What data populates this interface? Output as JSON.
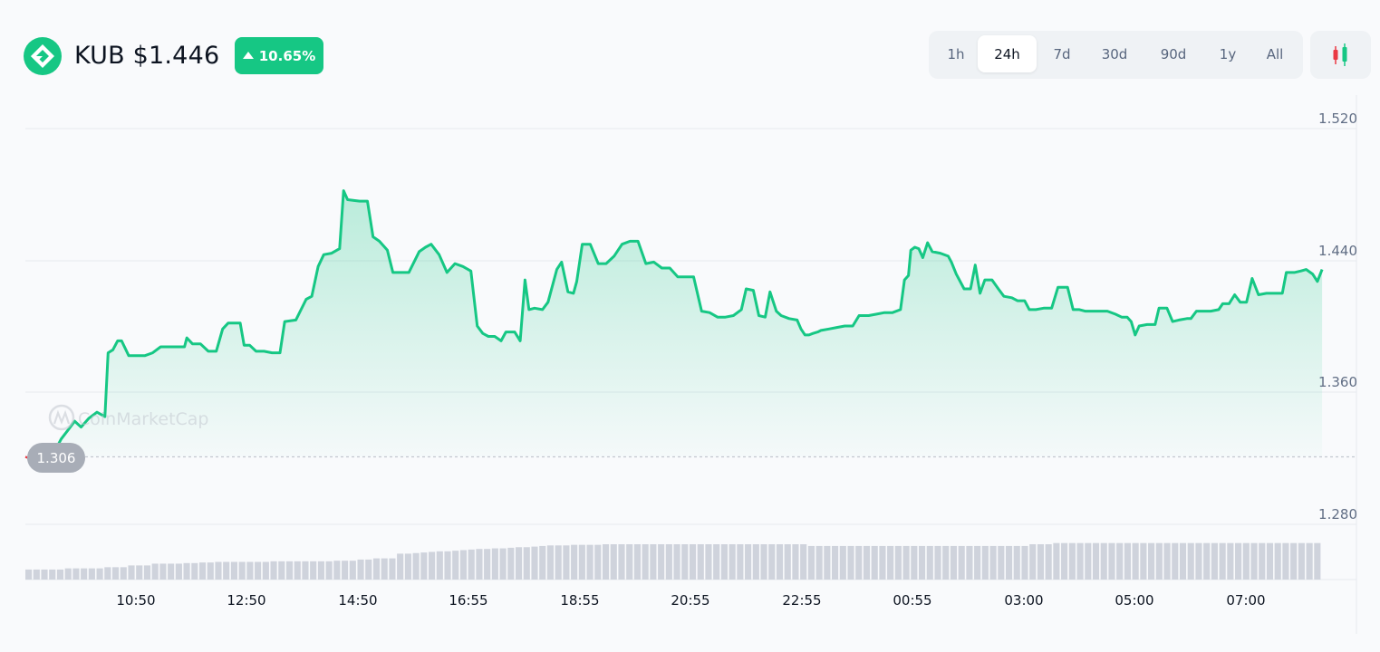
{
  "header": {
    "title": "KUB $1.446",
    "change": "10.65%",
    "change_direction": "up",
    "logo_icon": "kub-logo-icon",
    "accent_color": "#16c784"
  },
  "time_tabs": [
    {
      "label": "1h",
      "active": false
    },
    {
      "label": "24h",
      "active": true
    },
    {
      "label": "7d",
      "active": false
    },
    {
      "label": "30d",
      "active": false
    },
    {
      "label": "90d",
      "active": false
    },
    {
      "label": "1y",
      "active": false
    },
    {
      "label": "All",
      "active": false
    }
  ],
  "candle_button_icon": "candlestick-icon",
  "watermark": "CoinMarketCap",
  "chart_data": {
    "type": "area",
    "y_ticks": [
      "1.520",
      "1.440",
      "1.360",
      "1.280"
    ],
    "x_ticks": [
      "10:50",
      "12:50",
      "14:50",
      "16:55",
      "18:55",
      "20:55",
      "22:55",
      "00:55",
      "03:00",
      "05:00",
      "07:00"
    ],
    "reference_price": 1.306,
    "reference_label": "1.306",
    "ylim": [
      1.2606,
      1.5268
    ],
    "up_color": "#16c784",
    "down_color": "#ea3943",
    "grid": true,
    "series": [
      {
        "points": [
          [
            0.0,
            1.306
          ],
          [
            0.5,
            1.305
          ],
          [
            1.0,
            1.305
          ],
          [
            1.5,
            1.301
          ],
          [
            2.0,
            1.297
          ],
          [
            2.5,
            1.297
          ],
          [
            3.0,
            1.301
          ],
          [
            3.3,
            1.297
          ],
          [
            3.8,
            1.311
          ],
          [
            4.5,
            1.318
          ],
          [
            5.5,
            1.325
          ],
          [
            6.2,
            1.33
          ],
          [
            7.0,
            1.326
          ],
          [
            8.0,
            1.332
          ],
          [
            9.0,
            1.336
          ],
          [
            10.0,
            1.333
          ],
          [
            10.4,
            1.376
          ],
          [
            11.0,
            1.378
          ],
          [
            11.6,
            1.384
          ],
          [
            12.1,
            1.384
          ],
          [
            13.0,
            1.374
          ],
          [
            15.0,
            1.374
          ],
          [
            16.0,
            1.376
          ],
          [
            17.0,
            1.38
          ],
          [
            17.6,
            1.38
          ],
          [
            19.0,
            1.38
          ],
          [
            20.0,
            1.38
          ],
          [
            20.3,
            1.386
          ],
          [
            21.0,
            1.382
          ],
          [
            22.0,
            1.382
          ],
          [
            23.0,
            1.377
          ],
          [
            24.0,
            1.377
          ],
          [
            24.8,
            1.392
          ],
          [
            25.5,
            1.396
          ],
          [
            27.0,
            1.396
          ],
          [
            27.5,
            1.381
          ],
          [
            28.2,
            1.381
          ],
          [
            29.0,
            1.377
          ],
          [
            30.0,
            1.377
          ],
          [
            31.0,
            1.376
          ],
          [
            32.0,
            1.376
          ],
          [
            32.6,
            1.397
          ],
          [
            34.0,
            1.398
          ],
          [
            35.3,
            1.412
          ],
          [
            36.0,
            1.414
          ],
          [
            36.8,
            1.434
          ],
          [
            37.5,
            1.442
          ],
          [
            38.5,
            1.443
          ],
          [
            39.5,
            1.446
          ],
          [
            40.0,
            1.485
          ],
          [
            40.5,
            1.479
          ],
          [
            42.0,
            1.478
          ],
          [
            43.0,
            1.478
          ],
          [
            43.7,
            1.454
          ],
          [
            44.5,
            1.451
          ],
          [
            45.5,
            1.445
          ],
          [
            46.2,
            1.43
          ],
          [
            47.2,
            1.43
          ],
          [
            48.2,
            1.43
          ],
          [
            49.5,
            1.444
          ],
          [
            50.3,
            1.447
          ],
          [
            51.0,
            1.449
          ],
          [
            52.0,
            1.442
          ],
          [
            53.0,
            1.43
          ],
          [
            54.0,
            1.436
          ],
          [
            55.0,
            1.434
          ],
          [
            56.0,
            1.431
          ],
          [
            56.8,
            1.394
          ],
          [
            57.5,
            1.389
          ],
          [
            58.2,
            1.387
          ],
          [
            59.0,
            1.387
          ],
          [
            59.8,
            1.384
          ],
          [
            60.4,
            1.39
          ],
          [
            61.5,
            1.39
          ],
          [
            62.2,
            1.384
          ],
          [
            62.8,
            1.425
          ],
          [
            63.3,
            1.405
          ],
          [
            64.0,
            1.406
          ],
          [
            65.0,
            1.405
          ],
          [
            65.7,
            1.41
          ],
          [
            66.8,
            1.432
          ],
          [
            67.4,
            1.437
          ],
          [
            68.2,
            1.417
          ],
          [
            68.9,
            1.416
          ],
          [
            69.3,
            1.424
          ],
          [
            70.0,
            1.449
          ],
          [
            71.0,
            1.449
          ],
          [
            72.0,
            1.436
          ],
          [
            73.0,
            1.436
          ],
          [
            74.0,
            1.441
          ],
          [
            75.0,
            1.449
          ],
          [
            76.0,
            1.451
          ],
          [
            77.0,
            1.451
          ],
          [
            78.0,
            1.436
          ],
          [
            79.0,
            1.437
          ],
          [
            80.0,
            1.433
          ],
          [
            81.0,
            1.433
          ],
          [
            82.0,
            1.427
          ],
          [
            84.0,
            1.427
          ],
          [
            85.0,
            1.404
          ],
          [
            86.0,
            1.403
          ],
          [
            87.0,
            1.4
          ],
          [
            88.0,
            1.4
          ],
          [
            89.0,
            1.401
          ],
          [
            90.0,
            1.405
          ],
          [
            90.6,
            1.419
          ],
          [
            91.5,
            1.418
          ],
          [
            92.2,
            1.401
          ],
          [
            93.0,
            1.4
          ],
          [
            93.6,
            1.417
          ],
          [
            94.4,
            1.404
          ],
          [
            95.0,
            1.401
          ],
          [
            96.0,
            1.399
          ],
          [
            97.0,
            1.398
          ],
          [
            97.5,
            1.392
          ],
          [
            98.0,
            1.388
          ],
          [
            98.5,
            1.388
          ],
          [
            99.0,
            1.389
          ],
          [
            99.6,
            1.39
          ],
          [
            100.0,
            1.391
          ],
          [
            101.0,
            1.392
          ],
          [
            102.0,
            1.393
          ],
          [
            103.0,
            1.394
          ],
          [
            104.0,
            1.394
          ],
          [
            104.8,
            1.401
          ],
          [
            106.0,
            1.401
          ],
          [
            107.0,
            1.402
          ],
          [
            108.0,
            1.403
          ],
          [
            109.0,
            1.403
          ],
          [
            110.0,
            1.405
          ],
          [
            110.5,
            1.425
          ],
          [
            111.0,
            1.428
          ],
          [
            111.3,
            1.445
          ],
          [
            111.8,
            1.447
          ],
          [
            112.3,
            1.446
          ],
          [
            112.8,
            1.44
          ],
          [
            113.4,
            1.45
          ],
          [
            114.0,
            1.444
          ],
          [
            115.0,
            1.443
          ],
          [
            116.0,
            1.441
          ],
          [
            116.4,
            1.437
          ],
          [
            117.0,
            1.429
          ],
          [
            118.0,
            1.419
          ],
          [
            118.8,
            1.419
          ],
          [
            119.4,
            1.435
          ],
          [
            120.0,
            1.416
          ],
          [
            120.6,
            1.425
          ],
          [
            121.5,
            1.425
          ],
          [
            122.3,
            1.419
          ],
          [
            123.0,
            1.414
          ],
          [
            124.0,
            1.413
          ],
          [
            124.7,
            1.411
          ],
          [
            125.6,
            1.411
          ],
          [
            126.2,
            1.405
          ],
          [
            127.0,
            1.405
          ],
          [
            128.0,
            1.406
          ],
          [
            129.0,
            1.406
          ],
          [
            129.8,
            1.42
          ],
          [
            131.0,
            1.42
          ],
          [
            131.7,
            1.405
          ],
          [
            132.5,
            1.405
          ],
          [
            133.2,
            1.404
          ],
          [
            134.0,
            1.404
          ],
          [
            135.0,
            1.404
          ],
          [
            136.0,
            1.404
          ],
          [
            137.0,
            1.402
          ],
          [
            137.8,
            1.4
          ],
          [
            138.5,
            1.4
          ],
          [
            139.0,
            1.397
          ],
          [
            139.5,
            1.388
          ],
          [
            140.0,
            1.394
          ],
          [
            141.0,
            1.395
          ],
          [
            142.0,
            1.395
          ],
          [
            142.5,
            1.406
          ],
          [
            143.5,
            1.406
          ],
          [
            144.2,
            1.397
          ],
          [
            145.0,
            1.398
          ],
          [
            146.0,
            1.399
          ],
          [
            146.5,
            1.399
          ],
          [
            147.2,
            1.404
          ],
          [
            148.0,
            1.404
          ],
          [
            149.0,
            1.404
          ],
          [
            150.0,
            1.405
          ],
          [
            150.5,
            1.409
          ],
          [
            151.3,
            1.409
          ],
          [
            152.0,
            1.415
          ],
          [
            152.7,
            1.41
          ],
          [
            153.5,
            1.41
          ],
          [
            154.2,
            1.426
          ],
          [
            155.0,
            1.415
          ],
          [
            156.0,
            1.416
          ],
          [
            157.0,
            1.416
          ],
          [
            158.0,
            1.416
          ],
          [
            158.5,
            1.43
          ],
          [
            159.5,
            1.43
          ],
          [
            160.3,
            1.431
          ],
          [
            161.0,
            1.432
          ],
          [
            161.8,
            1.429
          ],
          [
            162.4,
            1.424
          ],
          [
            163.0,
            1.432
          ]
        ]
      }
    ],
    "volume": [
      0.17,
      0.17,
      0.17,
      0.17,
      0.17,
      0.19,
      0.19,
      0.19,
      0.19,
      0.19,
      0.21,
      0.21,
      0.21,
      0.24,
      0.24,
      0.24,
      0.27,
      0.27,
      0.27,
      0.27,
      0.28,
      0.28,
      0.29,
      0.29,
      0.3,
      0.3,
      0.3,
      0.3,
      0.3,
      0.3,
      0.3,
      0.31,
      0.31,
      0.31,
      0.31,
      0.31,
      0.31,
      0.31,
      0.31,
      0.32,
      0.32,
      0.32,
      0.34,
      0.34,
      0.36,
      0.36,
      0.36,
      0.44,
      0.44,
      0.45,
      0.46,
      0.47,
      0.48,
      0.48,
      0.49,
      0.5,
      0.51,
      0.52,
      0.52,
      0.53,
      0.53,
      0.54,
      0.55,
      0.55,
      0.56,
      0.57,
      0.58,
      0.58,
      0.58,
      0.59,
      0.59,
      0.59,
      0.59,
      0.6,
      0.6,
      0.6,
      0.6,
      0.6,
      0.6,
      0.6,
      0.6,
      0.6,
      0.6,
      0.6,
      0.6,
      0.6,
      0.6,
      0.6,
      0.6,
      0.6,
      0.6,
      0.6,
      0.6,
      0.6,
      0.6,
      0.6,
      0.6,
      0.6,
      0.6,
      0.57,
      0.57,
      0.57,
      0.57,
      0.57,
      0.57,
      0.57,
      0.57,
      0.57,
      0.57,
      0.57,
      0.57,
      0.57,
      0.57,
      0.57,
      0.57,
      0.57,
      0.57,
      0.57,
      0.57,
      0.57,
      0.57,
      0.57,
      0.57,
      0.57,
      0.57,
      0.57,
      0.57,
      0.6,
      0.6,
      0.6,
      0.62,
      0.62,
      0.62,
      0.62,
      0.62,
      0.62,
      0.62,
      0.62,
      0.62,
      0.62,
      0.62,
      0.62,
      0.62,
      0.62,
      0.62,
      0.62,
      0.62,
      0.62,
      0.62,
      0.62,
      0.62,
      0.62,
      0.62,
      0.62,
      0.62,
      0.62,
      0.62,
      0.62,
      0.62,
      0.62,
      0.62,
      0.62,
      0.62,
      0.62
    ]
  }
}
